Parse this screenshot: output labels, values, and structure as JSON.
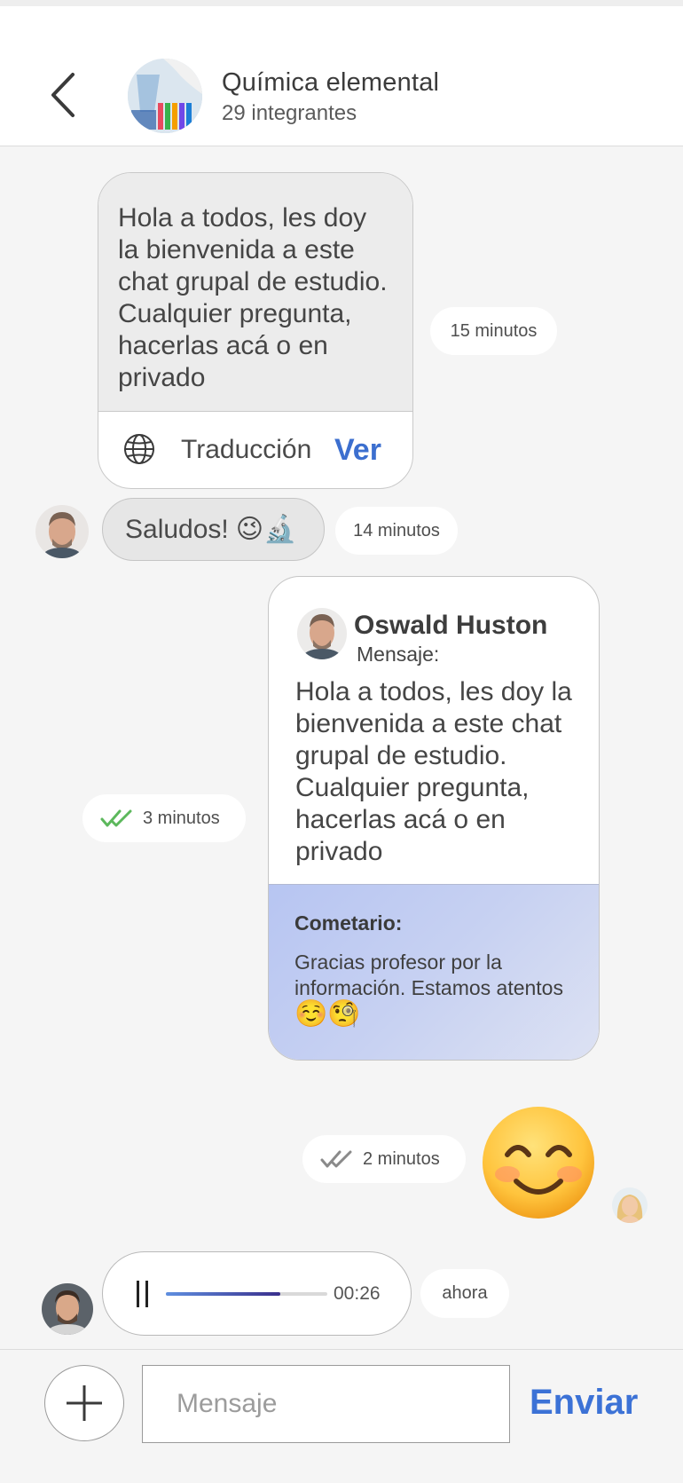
{
  "header": {
    "title": "Química elemental",
    "subtitle": "29 integrantes",
    "back_icon": "chevron-left-icon",
    "avatar": "chemistry-group-avatar"
  },
  "messages": {
    "first": {
      "text": "Hola a todos, les doy la bienvenida a este chat grupal de estudio. Cualquier pregunta, hacerlas acá o en privado",
      "translate_label": "Traducción",
      "view_label": "Ver",
      "time": "15 minutos"
    },
    "second": {
      "text": "Saludos!",
      "emojis": "😉🔬",
      "time": "14 minutos"
    },
    "quoted": {
      "author": "Oswald Huston",
      "label": "Mensaje:",
      "text": "Hola a todos, les doy la bienvenida a este chat grupal de estudio. Cualquier pregunta, hacerlas acá o en privado",
      "comment_title": "Cometario:",
      "comment_text": "Gracias profesor por la información. Estamos atentos",
      "comment_emojis": "☺️🧐",
      "time": "3 minutos",
      "status": "read"
    },
    "emoji_msg": {
      "time": "2 minutos",
      "emoji": "smiling-face-emoji",
      "status": "delivered"
    },
    "audio": {
      "duration": "00:26",
      "progress": 0.71,
      "time": "ahora"
    }
  },
  "composer": {
    "placeholder": "Mensaje",
    "send_label": "Enviar"
  },
  "colors": {
    "accent": "#3c72d6",
    "read_check": "#5cb85c",
    "delivered_check": "#8a8a8a",
    "comment_bg": "#c5cff2"
  }
}
